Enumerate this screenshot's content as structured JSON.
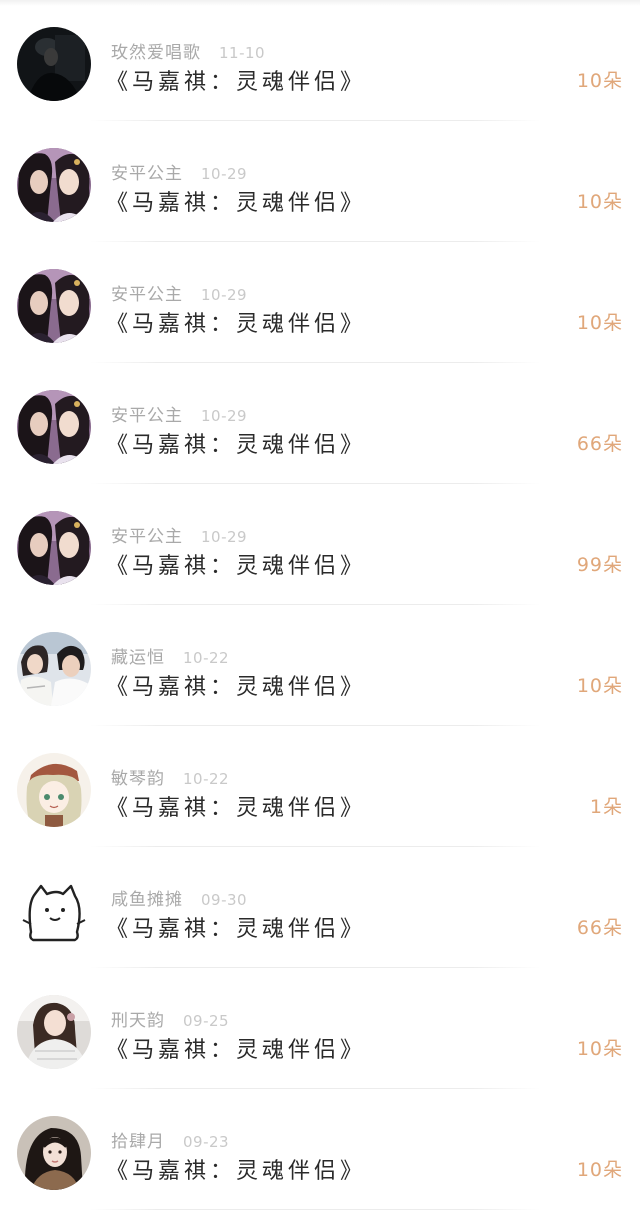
{
  "gift_list": {
    "items": [
      {
        "name": "玫然爱唱歌",
        "date": "11-10",
        "title": "《马嘉祺：灵魂伴侣》",
        "count": "10朵",
        "avatar": "dark-portrait-avatar"
      },
      {
        "name": "安平公主",
        "date": "10-29",
        "title": "《马嘉祺：灵魂伴侣》",
        "count": "10朵",
        "avatar": "couple-drama-avatar"
      },
      {
        "name": "安平公主",
        "date": "10-29",
        "title": "《马嘉祺：灵魂伴侣》",
        "count": "10朵",
        "avatar": "couple-drama-avatar"
      },
      {
        "name": "安平公主",
        "date": "10-29",
        "title": "《马嘉祺：灵魂伴侣》",
        "count": "66朵",
        "avatar": "couple-drama-avatar"
      },
      {
        "name": "安平公主",
        "date": "10-29",
        "title": "《马嘉祺：灵魂伴侣》",
        "count": "99朵",
        "avatar": "couple-drama-avatar"
      },
      {
        "name": "藏运恒",
        "date": "10-22",
        "title": "《马嘉祺：灵魂伴侣》",
        "count": "10朵",
        "avatar": "couple-selfie-avatar"
      },
      {
        "name": "敏琴韵",
        "date": "10-22",
        "title": "《马嘉祺：灵魂伴侣》",
        "count": "1朵",
        "avatar": "anime-girl-avatar"
      },
      {
        "name": "咸鱼摊摊",
        "date": "09-30",
        "title": "《马嘉祺：灵魂伴侣》",
        "count": "66朵",
        "avatar": "doodle-cat-avatar"
      },
      {
        "name": "刑天韵",
        "date": "09-25",
        "title": "《马嘉祺：灵魂伴侣》",
        "count": "10朵",
        "avatar": "girl-photo-avatar"
      },
      {
        "name": "拾肆月",
        "date": "09-23",
        "title": "《马嘉祺：灵魂伴侣》",
        "count": "10朵",
        "avatar": "girl-portrait-avatar"
      }
    ]
  },
  "colors": {
    "name": "#a9a9a9",
    "date": "#c9c9c9",
    "title": "#2a2a2a",
    "count": "#e0a77a",
    "divider": "#ececec"
  }
}
